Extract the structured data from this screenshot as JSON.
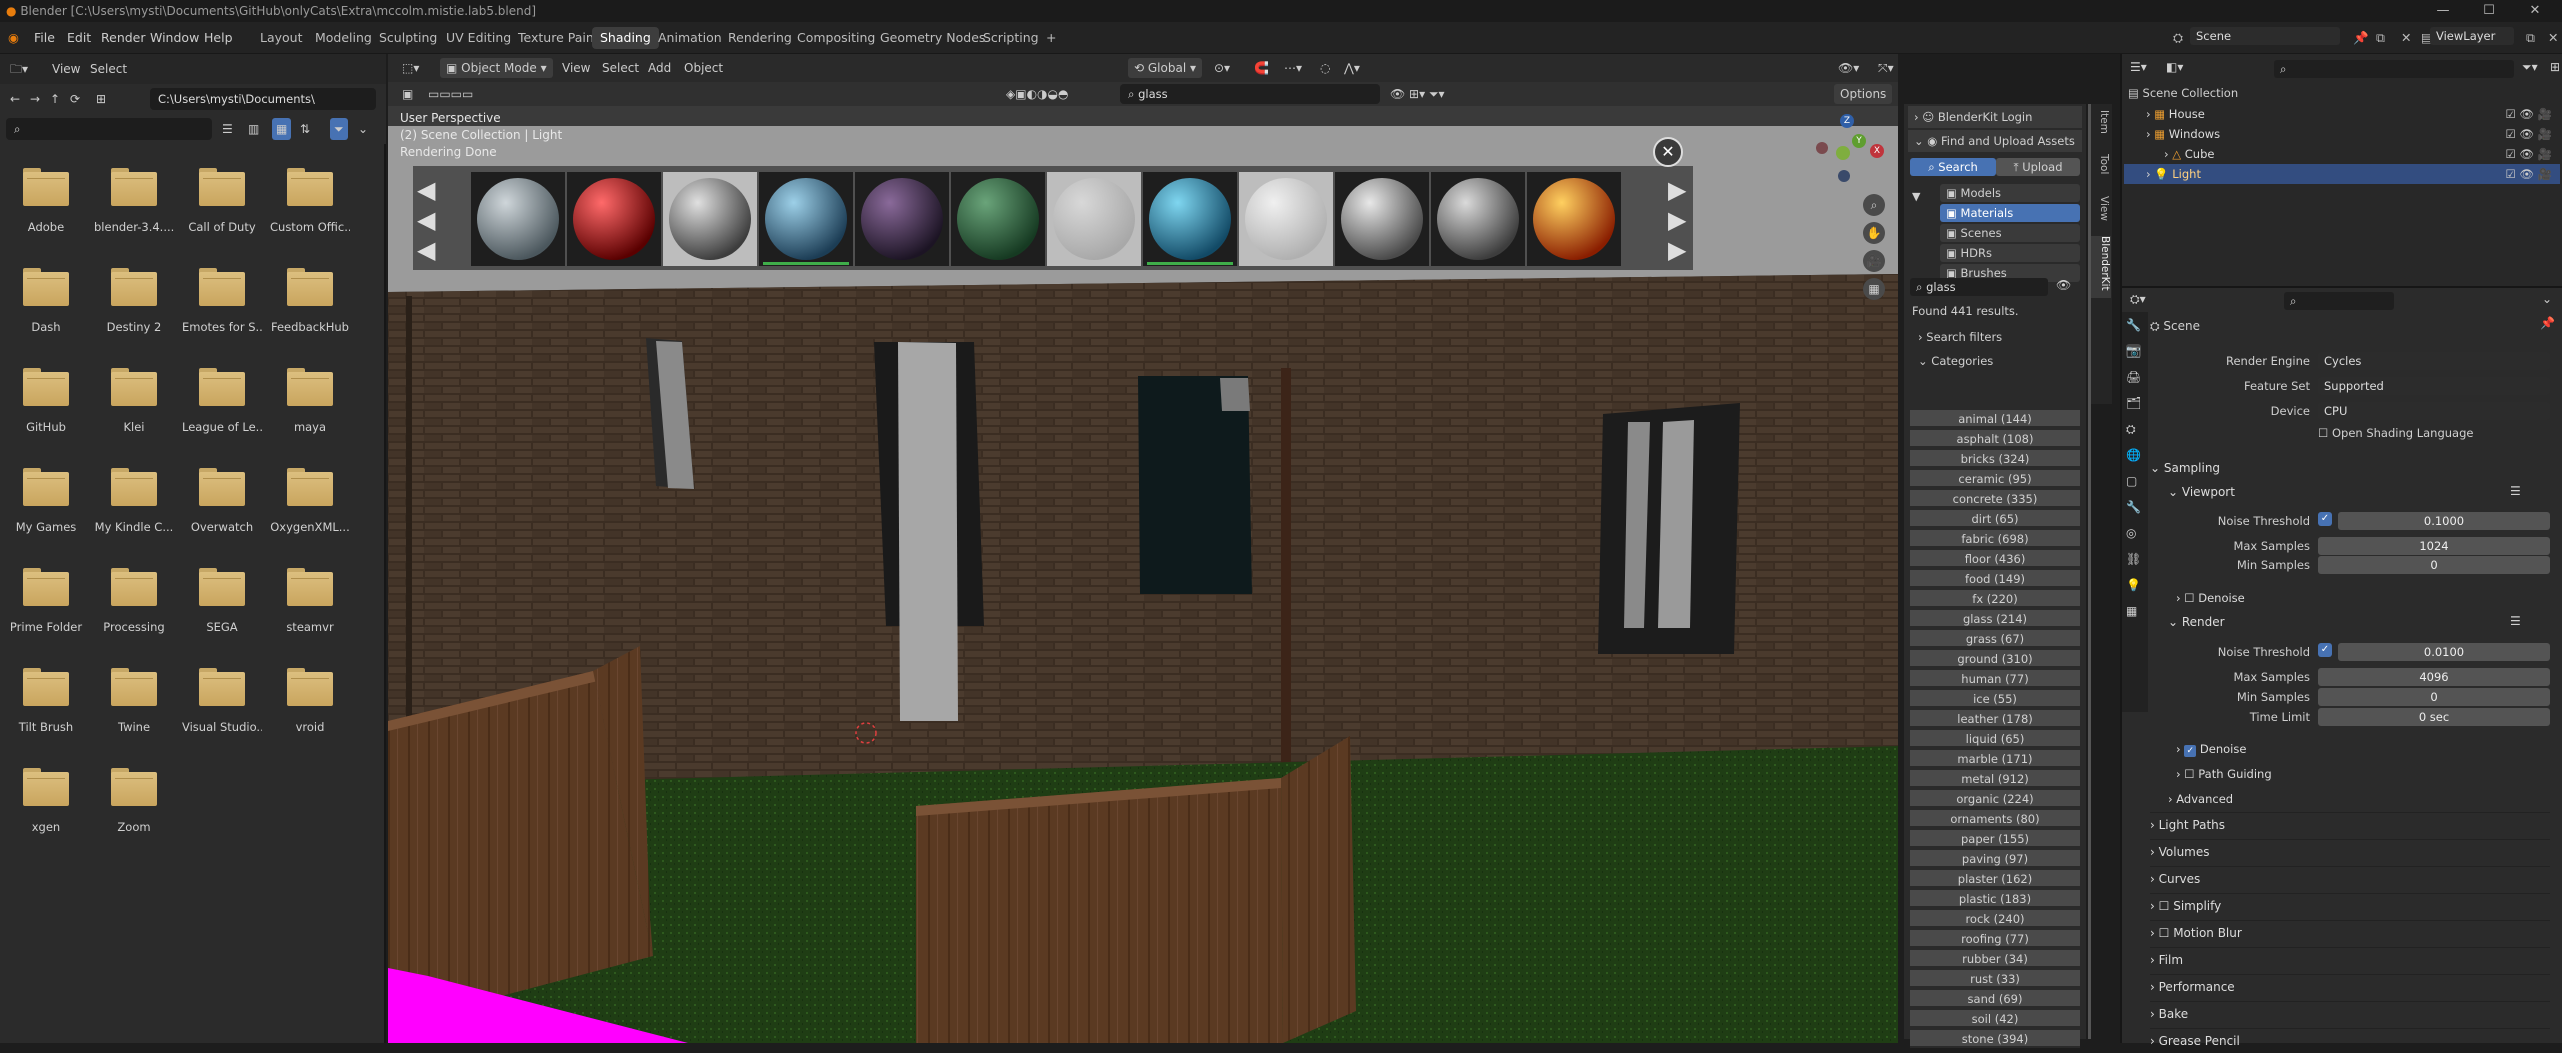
{
  "window_title": "Blender [C:\\Users\\mysti\\Documents\\GitHub\\onlyCats\\Extra\\mccolm.mistie.lab5.blend]",
  "menu": [
    "File",
    "Edit",
    "Render",
    "Window",
    "Help"
  ],
  "workspaces": [
    "Layout",
    "Modeling",
    "Sculpting",
    "UV Editing",
    "Texture Paint",
    "Shading",
    "Animation",
    "Rendering",
    "Compositing",
    "Geometry Nodes",
    "Scripting"
  ],
  "active_workspace": "Shading",
  "scene_name": "Scene",
  "view_layer": "ViewLayer",
  "filebrowser": {
    "view": "View",
    "select": "Select",
    "path": "C:\\Users\\mysti\\Documents\\",
    "folders": [
      "Adobe",
      "blender-3.4....",
      "Call of Duty",
      "Custom Offic...",
      "Dash",
      "Destiny 2",
      "Emotes for S...",
      "FeedbackHub",
      "GitHub",
      "Klei",
      "League of Le...",
      "maya",
      "My Games",
      "My Kindle C...",
      "Overwatch",
      "OxygenXML...",
      "Prime Folder",
      "Processing",
      "SEGA",
      "steamvr",
      "Tilt Brush",
      "Twine",
      "Visual Studio...",
      "vroid",
      "xgen",
      "Zoom"
    ]
  },
  "viewport": {
    "mode": "Object Mode",
    "view": "View",
    "select": "Select",
    "add": "Add",
    "object": "Object",
    "orientation": "Global",
    "search_value": "glass",
    "options": "Options",
    "overlay_line1": "User Perspective",
    "overlay_line2": "(2) Scene Collection | Light",
    "overlay_line3": "Rendering Done",
    "tabs": [
      "Item",
      "Tool",
      "View",
      "BlenderKit"
    ]
  },
  "blenderkit": {
    "login": "BlenderKit Login",
    "find_upload": "Find and Upload Assets",
    "search_btn": "Search",
    "upload_btn": "Upload",
    "asset_types": [
      "Models",
      "Materials",
      "Scenes",
      "HDRs",
      "Brushes"
    ],
    "active_type": "Materials",
    "search_value": "glass",
    "results": "Found 441 results.",
    "search_filters": "Search filters",
    "categories_label": "Categories",
    "categories": [
      "animal (144)",
      "asphalt (108)",
      "bricks (324)",
      "ceramic (95)",
      "concrete (335)",
      "dirt (65)",
      "fabric (698)",
      "floor (436)",
      "food (149)",
      "fx (220)",
      "glass (214)",
      "grass (67)",
      "ground (310)",
      "human (77)",
      "ice (55)",
      "leather (178)",
      "liquid (65)",
      "marble (171)",
      "metal (912)",
      "organic (224)",
      "ornaments (80)",
      "paper (155)",
      "paving (97)",
      "plaster (162)",
      "plastic (183)",
      "rock (240)",
      "roofing (77)",
      "rubber (34)",
      "rust (33)",
      "sand (69)",
      "soil (42)",
      "stone (394)"
    ]
  },
  "outliner": {
    "root": "Scene Collection",
    "items": [
      {
        "name": "House"
      },
      {
        "name": "Windows"
      },
      {
        "name": "Cube"
      },
      {
        "name": "Light"
      }
    ]
  },
  "properties": {
    "scene": "Scene",
    "render_engine_label": "Render Engine",
    "render_engine": "Cycles",
    "feature_set_label": "Feature Set",
    "feature_set": "Supported",
    "device_label": "Device",
    "device": "CPU",
    "osl": "Open Shading Language",
    "sampling": "Sampling",
    "viewport_sec": "Viewport",
    "noise_threshold_label": "Noise Threshold",
    "vp_noise": "0.1000",
    "max_samples_label": "Max Samples",
    "vp_max": "1024",
    "min_samples_label": "Min Samples",
    "vp_min": "0",
    "denoise": "Denoise",
    "render_sec": "Render",
    "r_noise": "0.0100",
    "r_max": "4096",
    "r_min": "0",
    "time_limit_label": "Time Limit",
    "r_time": "0 sec",
    "path_guiding": "Path Guiding",
    "advanced": "Advanced",
    "sections": [
      "Light Paths",
      "Volumes",
      "Curves",
      "Simplify",
      "Motion Blur",
      "Film",
      "Performance",
      "Bake",
      "Grease Pencil"
    ]
  },
  "colors": {
    "accent": "#4772b3",
    "selected_row": "#334d80",
    "magenta": "#ff00ff"
  }
}
